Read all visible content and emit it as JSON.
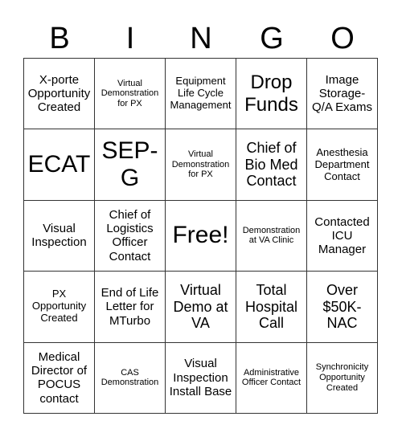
{
  "header": [
    "B",
    "I",
    "N",
    "G",
    "O"
  ],
  "cells": [
    {
      "text": "X-porte Opportunity Created",
      "size": "md"
    },
    {
      "text": "Virtual Demonstration for PX",
      "size": "xs"
    },
    {
      "text": "Equipment Life Cycle Management",
      "size": "sm"
    },
    {
      "text": "Drop Funds",
      "size": "xl"
    },
    {
      "text": "Image Storage-Q/A Exams",
      "size": "md"
    },
    {
      "text": "ECAT",
      "size": "xxl"
    },
    {
      "text": "SEP-G",
      "size": "xxl"
    },
    {
      "text": "Virtual Demonstration for PX",
      "size": "xs"
    },
    {
      "text": "Chief of Bio Med Contact",
      "size": "lg"
    },
    {
      "text": "Anesthesia Department Contact",
      "size": "sm"
    },
    {
      "text": "Visual Inspection",
      "size": "md"
    },
    {
      "text": "Chief of Logistics Officer Contact",
      "size": "md"
    },
    {
      "text": "Free!",
      "size": "xxl"
    },
    {
      "text": "Demonstration at VA Clinic",
      "size": "xs"
    },
    {
      "text": "Contacted ICU Manager",
      "size": "md"
    },
    {
      "text": "PX Opportunity Created",
      "size": "sm"
    },
    {
      "text": "End of Life Letter for MTurbo",
      "size": "md"
    },
    {
      "text": "Virtual Demo at VA",
      "size": "lg"
    },
    {
      "text": "Total Hospital Call",
      "size": "lg"
    },
    {
      "text": "Over $50K-NAC",
      "size": "lg"
    },
    {
      "text": "Medical Director of POCUS contact",
      "size": "md"
    },
    {
      "text": "CAS Demonstration",
      "size": "xs"
    },
    {
      "text": "Visual Inspection Install Base",
      "size": "md"
    },
    {
      "text": "Administrative Officer Contact",
      "size": "xs"
    },
    {
      "text": "Synchronicity Opportunity Created",
      "size": "xs"
    }
  ]
}
